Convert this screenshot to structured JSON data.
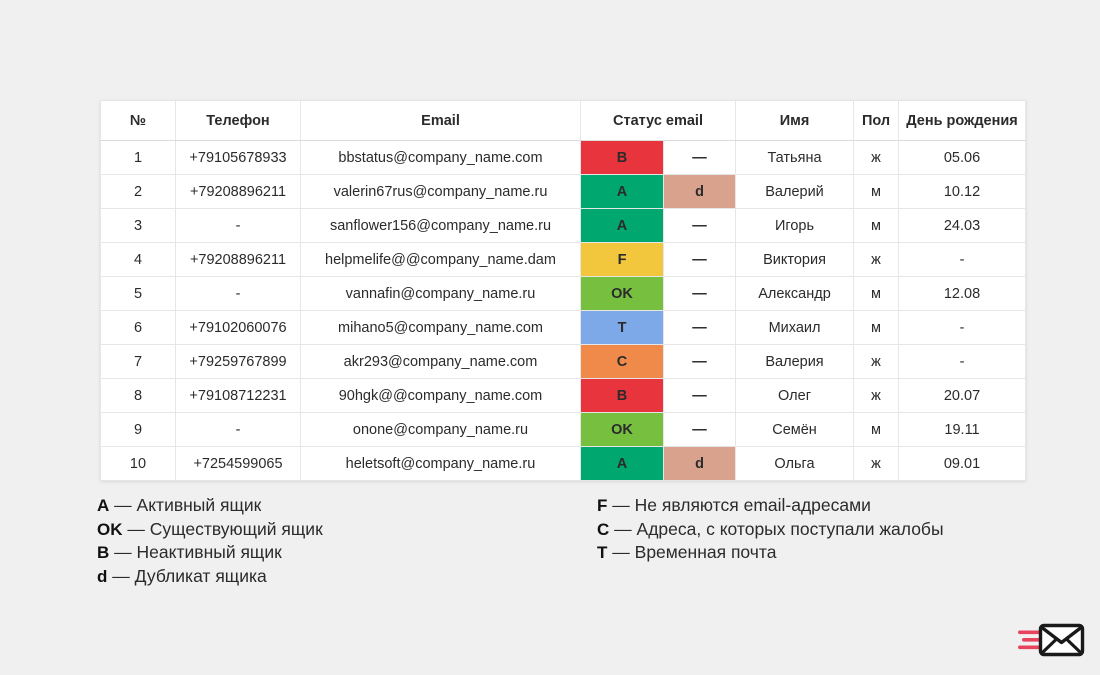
{
  "table": {
    "headers": [
      "№",
      "Телефон",
      "Email",
      "Статус email",
      "Имя",
      "Пол",
      "День рождения"
    ],
    "rows": [
      {
        "num": "1",
        "phone": "+79105678933",
        "email": "bbstatus@company_name.com",
        "status": "B",
        "dup": "—",
        "name": "Татьяна",
        "gender": "ж",
        "bday": "05.06"
      },
      {
        "num": "2",
        "phone": "+79208896211",
        "email": "valerin67rus@company_name.ru",
        "status": "A",
        "dup": "d",
        "name": "Валерий",
        "gender": "м",
        "bday": "10.12"
      },
      {
        "num": "3",
        "phone": "-",
        "email": "sanflower156@company_name.ru",
        "status": "A",
        "dup": "—",
        "name": "Игорь",
        "gender": "м",
        "bday": "24.03"
      },
      {
        "num": "4",
        "phone": "+79208896211",
        "email": "helpmelife@@company_name.dam",
        "status": "F",
        "dup": "—",
        "name": "Виктория",
        "gender": "ж",
        "bday": "-"
      },
      {
        "num": "5",
        "phone": "-",
        "email": "vannafin@company_name.ru",
        "status": "OK",
        "dup": "—",
        "name": "Александр",
        "gender": "м",
        "bday": "12.08"
      },
      {
        "num": "6",
        "phone": "+79102060076",
        "email": "mihano5@company_name.com",
        "status": "T",
        "dup": "—",
        "name": "Михаил",
        "gender": "м",
        "bday": "-"
      },
      {
        "num": "7",
        "phone": "+79259767899",
        "email": "akr293@company_name.com",
        "status": "C",
        "dup": "—",
        "name": "Валерия",
        "gender": "ж",
        "bday": "-"
      },
      {
        "num": "8",
        "phone": "+79108712231",
        "email": "90hgk@@company_name.com",
        "status": "B",
        "dup": "—",
        "name": "Олег",
        "gender": "ж",
        "bday": "20.07"
      },
      {
        "num": "9",
        "phone": "-",
        "email": "onone@company_name.ru",
        "status": "OK",
        "dup": "—",
        "name": "Семён",
        "gender": "м",
        "bday": "19.11"
      },
      {
        "num": "10",
        "phone": "+7254599065",
        "email": "heletsoft@company_name.ru",
        "status": "A",
        "dup": "d",
        "name": "Ольга",
        "gender": "ж",
        "bday": "09.01"
      }
    ]
  },
  "status_colors": {
    "A": "#00a870",
    "OK": "#76bf3f",
    "B": "#e8343c",
    "F": "#f2c63d",
    "T": "#7ea9e8",
    "C": "#f08a4b",
    "d": "#d9a28c",
    "empty": "#ffffff"
  },
  "legend": {
    "dash": "—",
    "left": [
      {
        "code": "A",
        "text": "Активный ящик"
      },
      {
        "code": "OK",
        "text": "Существующий ящик"
      },
      {
        "code": "B",
        "text": "Неактивный ящик"
      },
      {
        "code": "d",
        "text": "Дубликат ящика"
      }
    ],
    "right": [
      {
        "code": "F",
        "text": "Не являются email-адресами"
      },
      {
        "code": "C",
        "text": "Адреса, с которых поступали жалобы"
      },
      {
        "code": "T",
        "text": "Временная почта"
      }
    ]
  },
  "logo": {
    "name": "envelope-with-speed-lines",
    "envelope_color": "#1a1a1a",
    "lines_color": "#e8435c"
  },
  "page": {
    "background": "#f0f0f0"
  }
}
